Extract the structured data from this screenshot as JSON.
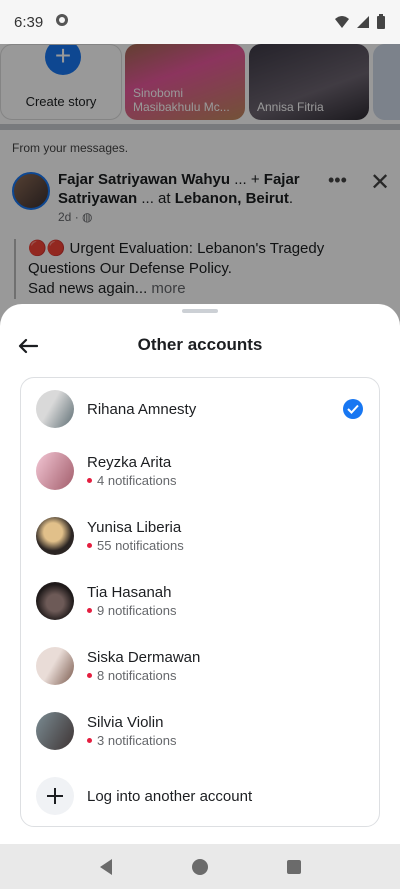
{
  "status_bar": {
    "time": "6:39"
  },
  "feed": {
    "create_story_label": "Create story",
    "stories": [
      {
        "name": "Sinobomi Masibakhulu Mc..."
      },
      {
        "name": "Annisa Fitria"
      }
    ],
    "section_label": "From your messages.",
    "post": {
      "author_1": "Fajar Satriyawan Wahyu",
      "connector_1": "... +",
      "author_2": "Fajar Satriyawan",
      "connector_2": "... at",
      "location": "Lebanon, Beirut",
      "time": "2d",
      "text_line_1": "🔴🔴 Urgent Evaluation: Lebanon's Tragedy Questions Our Defense Policy.",
      "text_line_2": "Sad news again...",
      "more_label": "more"
    }
  },
  "sheet": {
    "title": "Other accounts",
    "accounts": [
      {
        "name": "Rihana Amnesty",
        "notifications": "",
        "selected": true,
        "avatar_colors": [
          "#d9d9d9",
          "#5d6d73"
        ]
      },
      {
        "name": "Reyzka Arita",
        "notifications": "4 notifications",
        "selected": false,
        "avatar_colors": [
          "#f3c7d5",
          "#a25d6b"
        ]
      },
      {
        "name": "Yunisa Liberia",
        "notifications": "55 notifications",
        "selected": false,
        "avatar_colors": [
          "#e1c08a",
          "#2b2523"
        ]
      },
      {
        "name": "Tia Hasanah",
        "notifications": "9 notifications",
        "selected": false,
        "avatar_colors": [
          "#6d5a57",
          "#1f1a1a"
        ]
      },
      {
        "name": "Siska Dermawan",
        "notifications": "8 notifications",
        "selected": false,
        "avatar_colors": [
          "#e9dcd7",
          "#7a5a4d"
        ]
      },
      {
        "name": "Silvia Violin",
        "notifications": "3 notifications",
        "selected": false,
        "avatar_colors": [
          "#7b8c93",
          "#3e3434"
        ]
      }
    ],
    "add_account_label": "Log into another account"
  },
  "colors": {
    "accent": "#1877f2",
    "notification_dot": "#e41e3f"
  }
}
